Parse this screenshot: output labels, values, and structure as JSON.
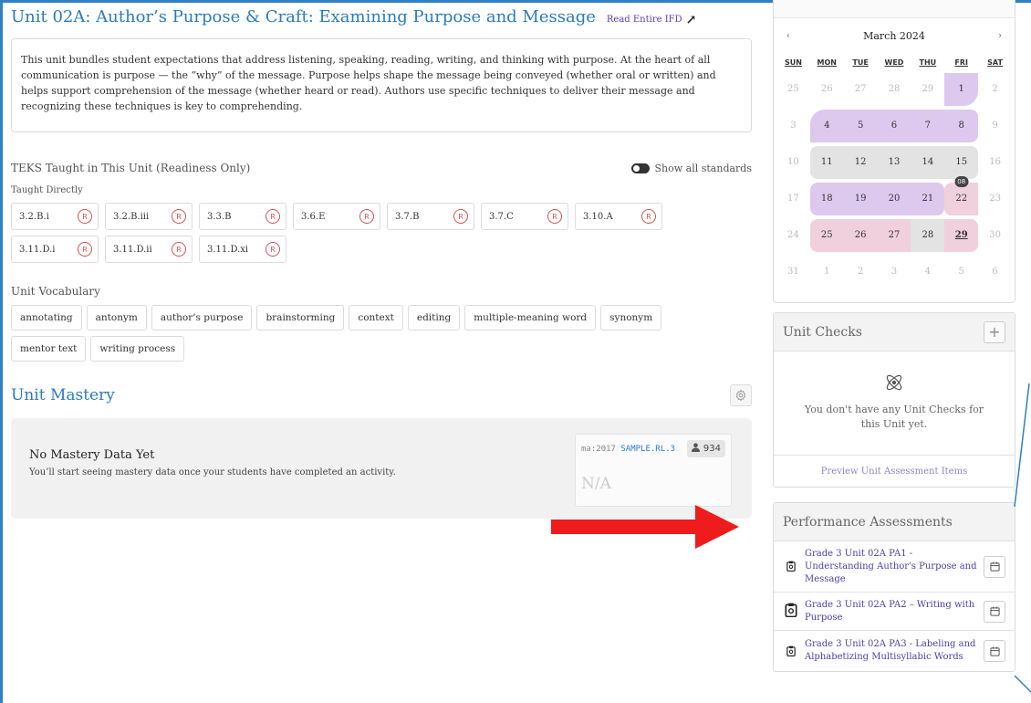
{
  "unit": {
    "title": "Unit 02A: Author’s Purpose & Craft: Examining Purpose and Message",
    "read_link": "Read Entire IFD",
    "description": "This unit bundles student expectations that address listening, speaking, reading, writing, and thinking with purpose. At the heart of all communication is purpose — the “why” of the message. Purpose helps shape the message being conveyed (whether oral or written) and helps support comprehension of the message (whether heard or read). Authors use specific techniques to deliver their message and recognizing these techniques is key to comprehending."
  },
  "teks": {
    "title": "TEKS Taught in This Unit (Readiness Only)",
    "toggle_label": "Show all standards",
    "taught_directly_label": "Taught Directly",
    "badge": "R",
    "items": [
      "3.2.B.i",
      "3.2.B.iii",
      "3.3.B",
      "3.6.E",
      "3.7.B",
      "3.7.C",
      "3.10.A",
      "3.11.D.i",
      "3.11.D.ii",
      "3.11.D.xi"
    ]
  },
  "vocab": {
    "title": "Unit Vocabulary",
    "items": [
      "annotating",
      "antonym",
      "author’s purpose",
      "brainstorming",
      "context",
      "editing",
      "multiple-meaning word",
      "synonym",
      "mentor text",
      "writing process"
    ]
  },
  "mastery": {
    "title": "Unit Mastery",
    "empty_title": "No Mastery Data Yet",
    "empty_desc": "You’ll start seeing mastery data once your students have completed an activity.",
    "card_code_prefix": "ma:2017",
    "card_code_value": "SAMPLE.RL.3",
    "card_count": "934",
    "card_value": "N/A"
  },
  "calendar": {
    "month": "March 2024",
    "prev": "‹",
    "next": "›",
    "weekdays": [
      "SUN",
      "MON",
      "TUE",
      "WED",
      "THU",
      "FRI",
      "SAT"
    ],
    "weeks": [
      [
        "25",
        "26",
        "27",
        "28",
        "29",
        "1",
        "2"
      ],
      [
        "3",
        "4",
        "5",
        "6",
        "7",
        "8",
        "9"
      ],
      [
        "10",
        "11",
        "12",
        "13",
        "14",
        "15",
        "16"
      ],
      [
        "17",
        "18",
        "19",
        "20",
        "21",
        "22",
        "23"
      ],
      [
        "24",
        "25",
        "26",
        "27",
        "28",
        "29",
        "30"
      ],
      [
        "31",
        "1",
        "2",
        "3",
        "4",
        "5",
        "6"
      ]
    ],
    "badge": "08",
    "colors": {
      "purple": "#ddc9ee",
      "gray": "#e3e3e3",
      "pink": "#f0d0dc"
    }
  },
  "unit_checks": {
    "title": "Unit Checks",
    "add": "+",
    "empty": "You don't have any Unit Checks for this Unit yet.",
    "preview_link": "Preview Unit Assessment Items"
  },
  "performance": {
    "title": "Performance Assessments",
    "items": [
      "Grade 3 Unit 02A PA1 - Understanding Author's Purpose and Message",
      "Grade 3 Unit 02A PA2 – Writing with Purpose",
      "Grade 3 Unit 02A PA3 - Labeling and Alphabetizing Multisyllabic Words"
    ]
  },
  "accent": {
    "blue": "#2b7bbf",
    "purple_link": "#4b3fa8",
    "red_arrow": "#ee1c1c"
  }
}
